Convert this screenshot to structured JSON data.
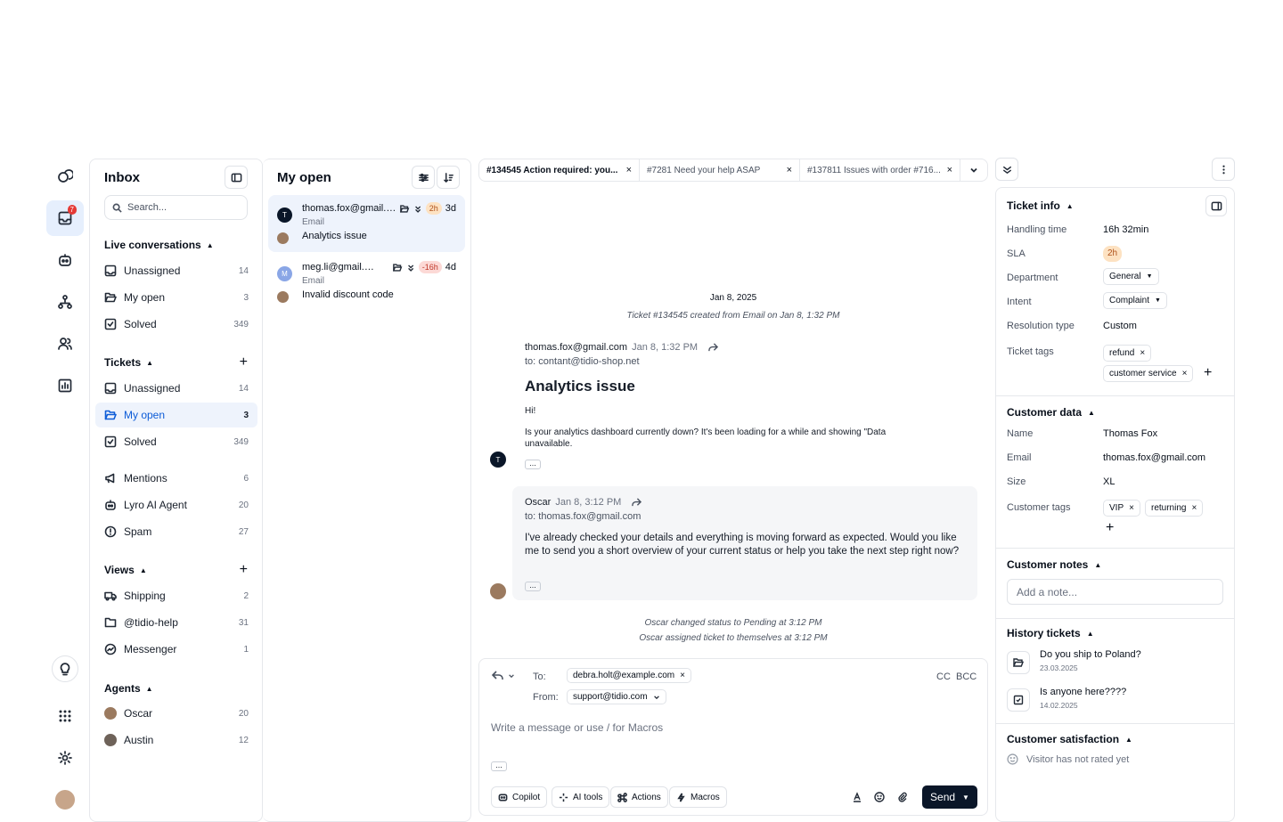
{
  "rail": {
    "inbox_badge": "7"
  },
  "inbox": {
    "title": "Inbox",
    "search_placeholder": "Search...",
    "live": {
      "label": "Live conversations",
      "items": [
        {
          "label": "Unassigned",
          "count": "14"
        },
        {
          "label": "My open",
          "count": "3"
        },
        {
          "label": "Solved",
          "count": "349"
        }
      ]
    },
    "tickets": {
      "label": "Tickets",
      "items": [
        {
          "label": "Unassigned",
          "count": "14"
        },
        {
          "label": "My open",
          "count": "3"
        },
        {
          "label": "Solved",
          "count": "349"
        }
      ]
    },
    "other": [
      {
        "label": "Mentions",
        "count": "6"
      },
      {
        "label": "Lyro AI Agent",
        "count": "20"
      },
      {
        "label": "Spam",
        "count": "27"
      }
    ],
    "views": {
      "label": "Views",
      "items": [
        {
          "label": "Shipping",
          "count": "2"
        },
        {
          "label": "@tidio-help",
          "count": "31"
        },
        {
          "label": "Messenger",
          "count": "1"
        }
      ]
    },
    "agents": {
      "label": "Agents",
      "items": [
        {
          "label": "Oscar",
          "count": "20"
        },
        {
          "label": "Austin",
          "count": "12"
        }
      ]
    }
  },
  "list": {
    "title": "My open",
    "cards": [
      {
        "avatar": "T",
        "email": "thomas.fox@gmail.co...",
        "sla": "2h",
        "age": "3d",
        "channel": "Email",
        "subject": "Analytics issue"
      },
      {
        "avatar": "M",
        "email": "meg.li@gmail.com",
        "sla": "-16h",
        "age": "4d",
        "channel": "Email",
        "subject": "Invalid discount code"
      }
    ]
  },
  "tabs": [
    {
      "label": "#134545  Action required: you..."
    },
    {
      "label": "#7281  Need your help ASAP"
    },
    {
      "label": "#137811  Issues with order #716..."
    }
  ],
  "conversation": {
    "date": "Jan 8, 2025",
    "created": "Ticket #134545 created from Email on Jan 8, 1:32 PM",
    "m1": {
      "avatar": "T",
      "from": "thomas.fox@gmail.com",
      "time": "Jan 8, 1:32 PM",
      "to": "to: contant@tidio-shop.net",
      "subject": "Analytics issue",
      "greeting": "Hi!",
      "body": "Is your analytics dashboard currently down? It's been loading for a while and showing \"Data unavailable."
    },
    "m2": {
      "from": "Oscar",
      "time": "Jan 8, 3:12 PM",
      "to": "to: thomas.fox@gmail.com",
      "body": "I've already checked your details and everything is moving forward as expected. Would you like me to send you a short overview of your current status or help you take the next step right now?"
    },
    "event1": "Oscar changed status to Pending at 3:12 PM",
    "event2": "Oscar assigned ticket to themselves at 3:12 PM"
  },
  "composer": {
    "to_label": "To:",
    "to_value": "debra.holt@example.com",
    "from_label": "From:",
    "from_value": "support@tidio.com",
    "cc": "CC",
    "bcc": "BCC",
    "placeholder": "Write a message or use / for Macros",
    "tools": [
      "Copilot",
      "AI tools",
      "Actions",
      "Macros"
    ],
    "send": "Send"
  },
  "info": {
    "ticket_info": "Ticket info",
    "rows": {
      "handling_label": "Handling time",
      "handling_value": "16h 32min",
      "sla_label": "SLA",
      "sla_value": "2h",
      "dept_label": "Department",
      "dept_value": "General",
      "intent_label": "Intent",
      "intent_value": "Complaint",
      "res_label": "Resolution type",
      "res_value": "Custom",
      "tags_label": "Ticket tags",
      "tag1": "refund",
      "tag2": "customer service"
    },
    "customer_data": "Customer data",
    "cust": {
      "name_label": "Name",
      "name_value": "Thomas Fox",
      "email_label": "Email",
      "email_value": "thomas.fox@gmail.com",
      "size_label": "Size",
      "size_value": "XL",
      "tags_label": "Customer tags",
      "tag1": "VIP",
      "tag2": "returning"
    },
    "notes": "Customer notes",
    "notes_placeholder": "Add a note...",
    "history": "History tickets",
    "history_items": [
      {
        "title": "Do you ship to Poland?",
        "date": "23.03.2025"
      },
      {
        "title": "Is anyone here????",
        "date": "14.02.2025"
      }
    ],
    "satisfaction": "Customer satisfaction",
    "satisfaction_value": "Visitor has not rated yet"
  },
  "colors": {
    "accent": "#0d5cd7",
    "sla_warn": "#fde2c2",
    "sla_bad": "#fcd9d6",
    "send_bg": "#0a1628"
  }
}
